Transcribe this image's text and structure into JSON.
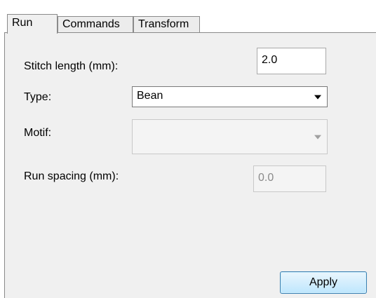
{
  "tabs": [
    {
      "label": "Run",
      "active": true
    },
    {
      "label": "Commands",
      "active": false
    },
    {
      "label": "Transform",
      "active": false
    }
  ],
  "fields": {
    "stitch_length": {
      "label": "Stitch length (mm):",
      "value": "2.0"
    },
    "type": {
      "label": "Type:",
      "value": "Bean"
    },
    "motif": {
      "label": "Motif:",
      "value": ""
    },
    "run_spacing": {
      "label": "Run spacing (mm):",
      "value": "0.0"
    }
  },
  "apply_label": "Apply"
}
